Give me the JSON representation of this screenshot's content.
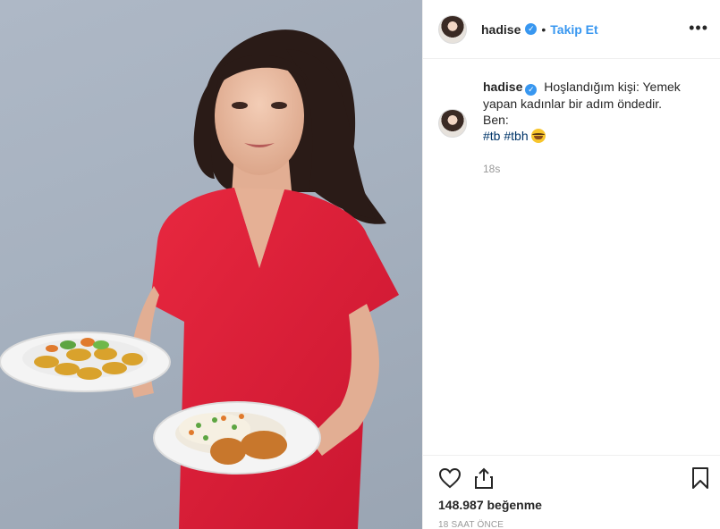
{
  "post": {
    "image_description_icon": "post-photo",
    "header": {
      "username": "hadise",
      "verified_icon": "verified-badge-icon",
      "separator": "•",
      "follow_label": "Takip Et",
      "more_icon": "more-options-icon",
      "more_label": "•••"
    },
    "caption": {
      "username": "hadise",
      "text_line": "Hoşlandığım kişi: Yemek yapan kadınlar bir adım öndedir.",
      "text_line2": "Ben:",
      "hashtag1": "#tb",
      "hashtag2": "#tbh",
      "emoji_icon": "laughing-tears-emoji-icon",
      "time": "18s"
    },
    "actions": {
      "like_icon": "heart-icon",
      "share_icon": "share-icon",
      "save_icon": "bookmark-icon",
      "likes": "148.987 beğenme",
      "age": "18 SAAT ÖNCE"
    }
  },
  "colors": {
    "link": "#3897f0",
    "hashtag": "#003569",
    "muted": "#999999",
    "dress": "#dd1f3b"
  }
}
